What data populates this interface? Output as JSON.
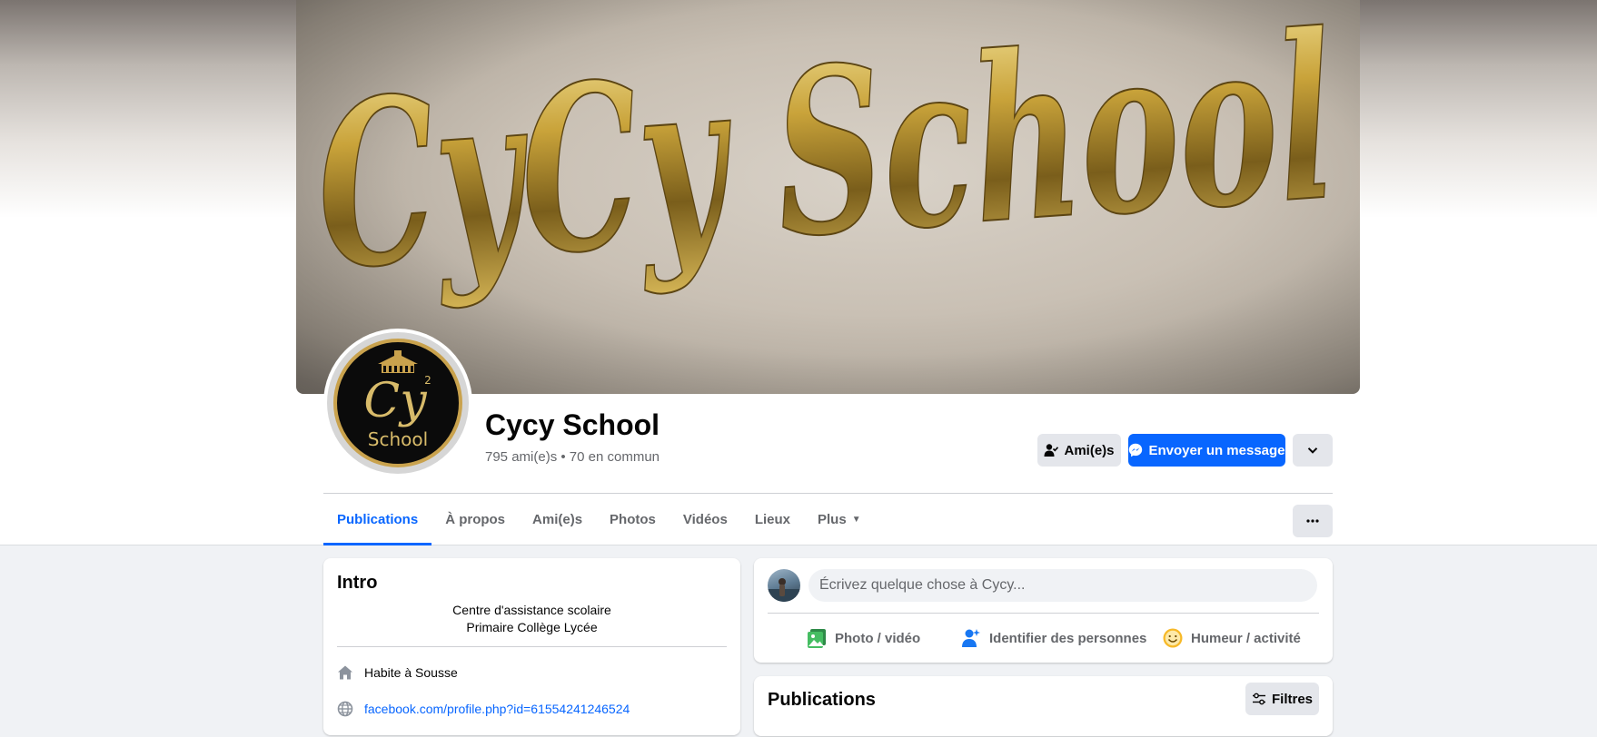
{
  "cover": {
    "text": "CyCy School"
  },
  "avatar": {
    "logo_text": "Cy",
    "logo_superscript": "2",
    "logo_subtext": "School"
  },
  "profile": {
    "name": "Cycy School",
    "friends_line": "795 ami(e)s • 70 en commun"
  },
  "actions": {
    "friends_label": "Ami(e)s",
    "message_label": "Envoyer un message",
    "more_icon": "chevron-down-icon"
  },
  "tabs": [
    {
      "label": "Publications",
      "active": true
    },
    {
      "label": "À propos"
    },
    {
      "label": "Ami(e)s"
    },
    {
      "label": "Photos"
    },
    {
      "label": "Vidéos"
    },
    {
      "label": "Lieux"
    },
    {
      "label": "Plus"
    }
  ],
  "tab_more_button_icon": "ellipsis-icon",
  "intro": {
    "title": "Intro",
    "bio_line1": "Centre d'assistance scolaire",
    "bio_line2": "Primaire Collège Lycée",
    "lives_prefix": "Habite à ",
    "lives_city": "Sousse",
    "link": "facebook.com/profile.php?id=61554241246524"
  },
  "composer": {
    "placeholder": "Écrivez quelque chose à Cycy...",
    "photo_label": "Photo / vidéo",
    "tag_label": "Identifier des personnes",
    "feeling_label": "Humeur / activité"
  },
  "publications": {
    "title": "Publications",
    "filters_label": "Filtres"
  },
  "colors": {
    "accent": "#0866ff",
    "gold": "#c9a24d",
    "photo_green": "#45bd62",
    "feeling_yellow": "#f7b928"
  }
}
